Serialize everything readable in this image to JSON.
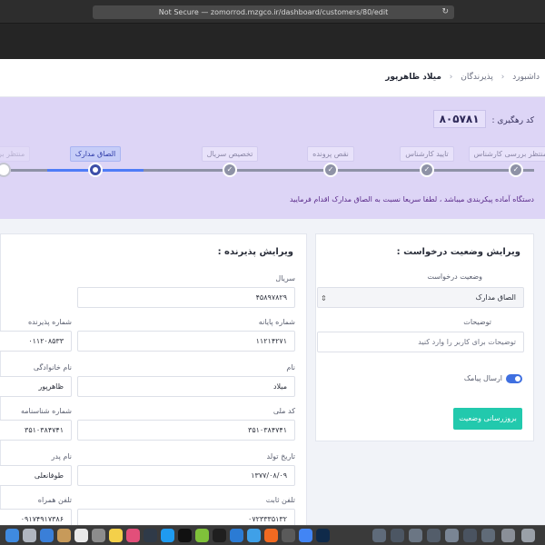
{
  "browser": {
    "url_text": "Not Secure — zomorrod.mzgco.ir/dashboard/customers/80/edit",
    "reload_icon": "reload-icon"
  },
  "breadcrumb": {
    "items": [
      "داشبورد",
      "پذیرندگان",
      "میلاد ظاهرپور"
    ],
    "separator": "‹"
  },
  "tracking": {
    "label": "کد رهگیری :",
    "code": "۸۰۵۷۸۱"
  },
  "stepper": {
    "steps": [
      {
        "label": "منتظر بررسی کارشناس",
        "state": "done"
      },
      {
        "label": "تایید کارشناس",
        "state": "done"
      },
      {
        "label": "نقص پرونده",
        "state": "done"
      },
      {
        "label": "تخصیص سریال",
        "state": "done"
      },
      {
        "label": "الصاق مدارک",
        "state": "current"
      },
      {
        "label": "منتظر بررسی",
        "state": "pending"
      }
    ]
  },
  "notice": "دستگاه آماده پیکربندی میباشد ، لطفا سریعا نسبت به الصاق مدارک اقدام فرمایید",
  "status_card": {
    "title": "ویرایش وضعیت درخواست :",
    "status_label": "وضعیت درخواست",
    "status_value": "الصاق مدارک",
    "description_label": "توضیحات",
    "description_placeholder": "توضیحات برای کاربر را وارد کنید",
    "sms_label": "ارسال پیامک",
    "sms_enabled": true,
    "update_button": "بروزرسانی وضعیت"
  },
  "receiver_card": {
    "title": "ویرایش پذیرنده :",
    "fields": {
      "serial_label": "سریال",
      "serial_value": "۴۵۸۹۷۸۲۹",
      "terminal_label": "شماره پایانه",
      "terminal_value": "۱۱۲۱۴۲۷۱",
      "acceptor_label": "شماره پذیرنده",
      "acceptor_value": "۰۱۱۲۰۸۵۳۳",
      "firstname_label": "نام",
      "firstname_value": "میلاد",
      "lastname_label": "نام خانوادگی",
      "lastname_value": "ظاهرپور",
      "national_label": "کد ملی",
      "national_value": "۳۵۱۰۳۸۴۷۴۱",
      "id_label": "شماره شناسنامه",
      "id_value": "۳۵۱۰۳۸۴۷۴۱",
      "birth_label": "تاریخ تولد",
      "birth_value": "۱۳۷۷/۰۸/۰۹",
      "father_label": "نام پدر",
      "father_value": "طوفانعلی",
      "phone_label": "تلفن ثابت",
      "phone_value": "۰۷۲۳۳۳۵۱۳۲",
      "mobile_label": "تلفن همراه",
      "mobile_value": "۰۹۱۷۴۹۱۷۳۸۶"
    }
  },
  "colors": {
    "panel_bg": "#ddd5f6",
    "accent_blue": "#4f7cf7",
    "update_button": "#22c9ad"
  }
}
